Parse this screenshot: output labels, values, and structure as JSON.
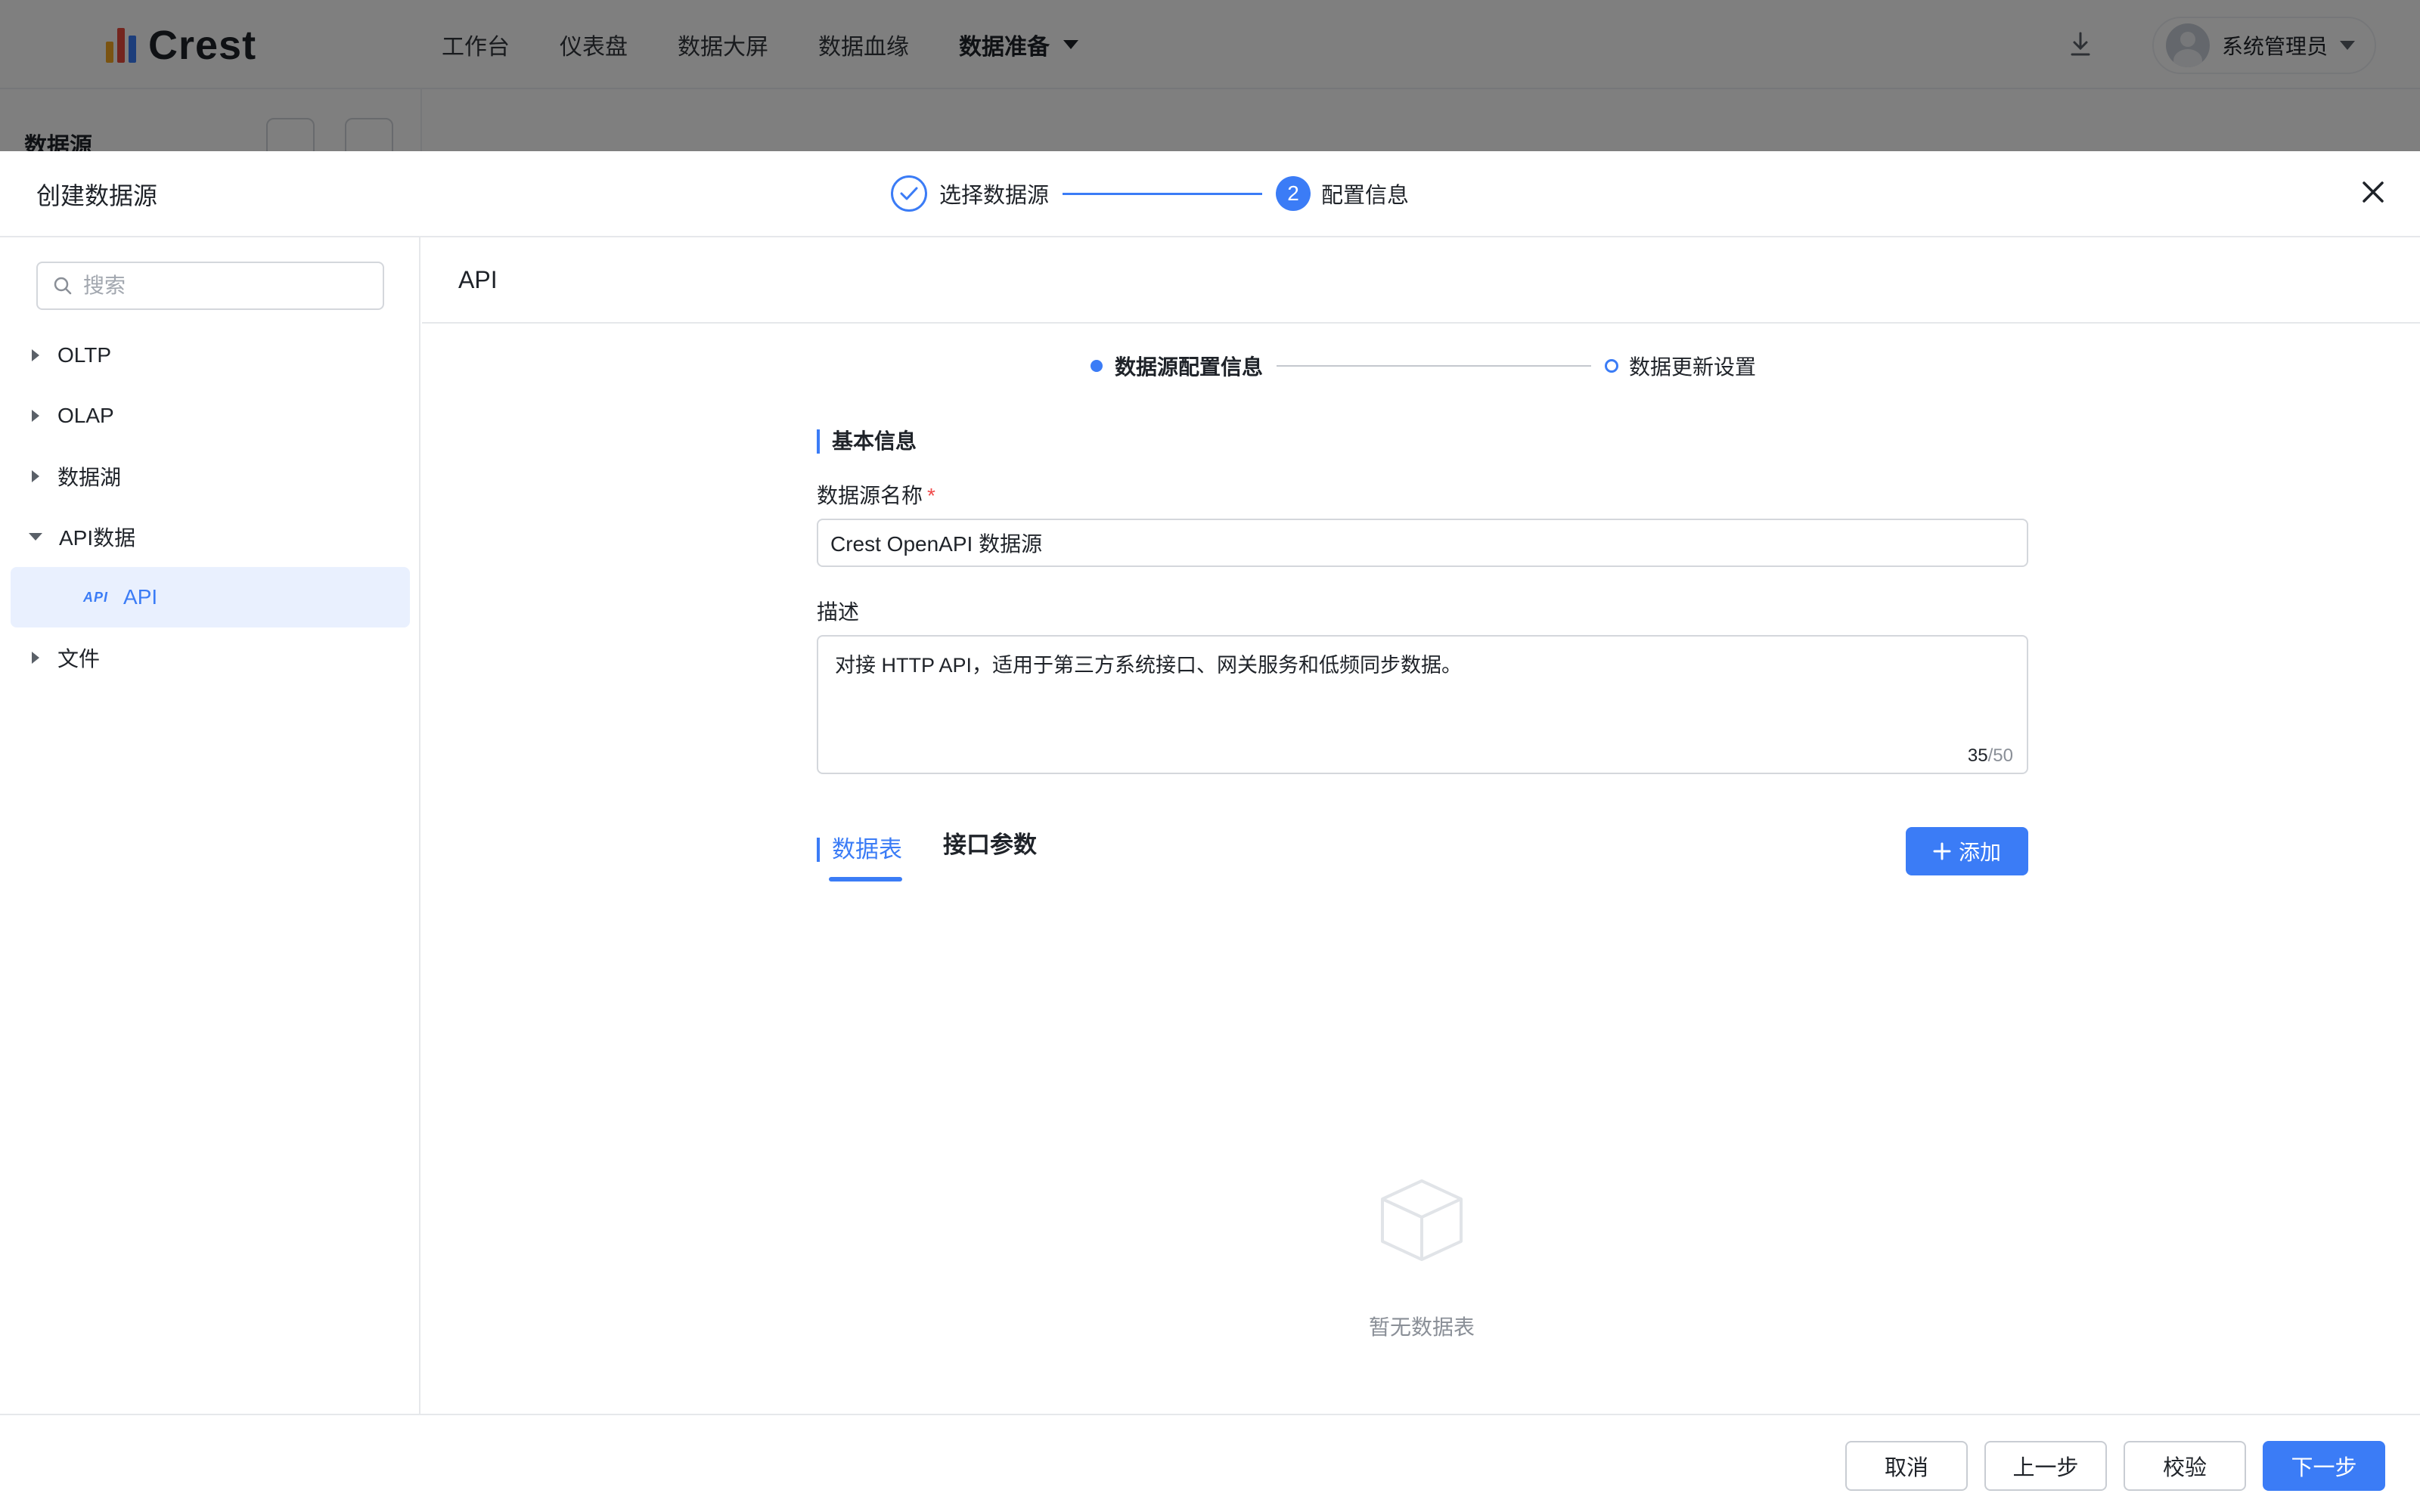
{
  "app": {
    "logo_text": "Crest",
    "logo_colors": [
      "#f5a623",
      "#e94b3c",
      "#3b7cf6"
    ],
    "nav": [
      "工作台",
      "仪表盘",
      "数据大屏",
      "数据血缘"
    ],
    "nav_active": "数据准备",
    "user_name": "系统管理员",
    "sidebar_title": "数据源"
  },
  "drawer": {
    "title": "创建数据源",
    "steps": [
      {
        "label": "选择数据源",
        "state": "done"
      },
      {
        "label": "配置信息",
        "number": "2",
        "state": "active"
      }
    ]
  },
  "left": {
    "search_placeholder": "搜索",
    "tree": [
      {
        "label": "OLTP",
        "expanded": false
      },
      {
        "label": "OLAP",
        "expanded": false
      },
      {
        "label": "数据湖",
        "expanded": false
      },
      {
        "label": "API数据",
        "expanded": true,
        "children": [
          {
            "tag": "API",
            "label": "API",
            "selected": true
          }
        ]
      },
      {
        "label": "文件",
        "expanded": false
      }
    ]
  },
  "right": {
    "title": "API",
    "substeps": [
      "数据源配置信息",
      "数据更新设置"
    ],
    "section_title": "基本信息",
    "name_label": "数据源名称",
    "name_required": "*",
    "name_value": "Crest OpenAPI 数据源",
    "desc_label": "描述",
    "desc_value": "对接 HTTP API，适用于第三方系统接口、网关服务和低频同步数据。",
    "desc_count": "35",
    "desc_max": "/50",
    "tabs": [
      "数据表",
      "接口参数"
    ],
    "add_label": "添加",
    "empty_text": "暂无数据表"
  },
  "footer": {
    "cancel": "取消",
    "prev": "上一步",
    "verify": "校验",
    "next": "下一步"
  },
  "colors": {
    "primary": "#3b7cf6",
    "required": "#f04b4b",
    "selected_bg": "#e9f0fe"
  }
}
